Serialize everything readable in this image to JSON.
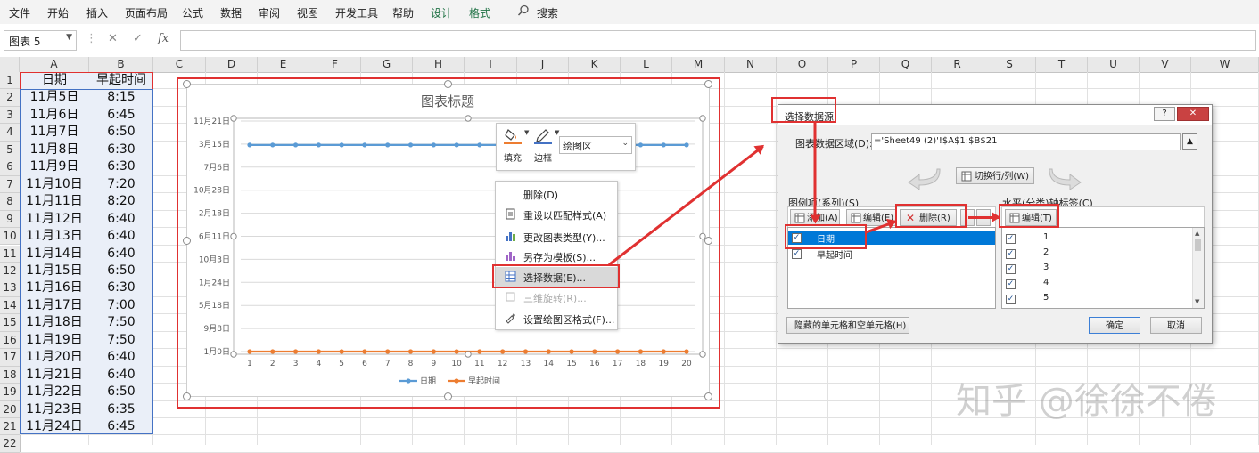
{
  "ribbon": {
    "tabs": [
      "文件",
      "开始",
      "插入",
      "页面布局",
      "公式",
      "数据",
      "审阅",
      "视图",
      "开发工具",
      "帮助",
      "设计",
      "格式"
    ],
    "search_label": "搜索",
    "context_color": "#217346"
  },
  "formula_bar": {
    "name_box": "图表 5",
    "cancel": "✕",
    "enter": "✓",
    "fx": "fx",
    "value": ""
  },
  "columns": [
    "A",
    "B",
    "C",
    "D",
    "E",
    "F",
    "G",
    "H",
    "I",
    "J",
    "K",
    "L",
    "M",
    "N",
    "O",
    "P",
    "Q",
    "R",
    "S",
    "T",
    "U",
    "V",
    "W"
  ],
  "rows": [
    "1",
    "2",
    "3",
    "4",
    "5",
    "6",
    "7",
    "8",
    "9",
    "10",
    "11",
    "12",
    "13",
    "14",
    "15",
    "16",
    "17",
    "18",
    "19",
    "20",
    "21",
    "22"
  ],
  "sheet": {
    "header": [
      "日期",
      "早起时间"
    ],
    "data": [
      [
        "11月5日",
        "8:15"
      ],
      [
        "11月6日",
        "6:45"
      ],
      [
        "11月7日",
        "6:50"
      ],
      [
        "11月8日",
        "6:30"
      ],
      [
        "11月9日",
        "6:30"
      ],
      [
        "11月10日",
        "7:20"
      ],
      [
        "11月11日",
        "8:20"
      ],
      [
        "11月12日",
        "6:40"
      ],
      [
        "11月13日",
        "6:40"
      ],
      [
        "11月14日",
        "6:40"
      ],
      [
        "11月15日",
        "6:50"
      ],
      [
        "11月16日",
        "6:30"
      ],
      [
        "11月17日",
        "7:00"
      ],
      [
        "11月18日",
        "7:50"
      ],
      [
        "11月19日",
        "7:50"
      ],
      [
        "11月20日",
        "6:40"
      ],
      [
        "11月21日",
        "6:40"
      ],
      [
        "11月22日",
        "6:50"
      ],
      [
        "11月23日",
        "6:35"
      ],
      [
        "11月24日",
        "6:45"
      ]
    ]
  },
  "chart": {
    "title": "图表标题",
    "colors": {
      "date": "#5b9bd5",
      "wake": "#ed7d31"
    },
    "chart_data": {
      "type": "line",
      "title": "图表标题",
      "x": [
        1,
        2,
        3,
        4,
        5,
        6,
        7,
        8,
        9,
        10,
        11,
        12,
        13,
        14,
        15,
        16,
        17,
        18,
        19,
        20
      ],
      "y_tick_labels": [
        "1月0日",
        "9月8日",
        "5月18日",
        "1月24日",
        "10月3日",
        "6月11日",
        "2月18日",
        "10月28日",
        "7月6日",
        "3月15日",
        "11月21日"
      ],
      "series": [
        {
          "name": "日期",
          "values": [
            "11月5日",
            "11月6日",
            "11月7日",
            "11月8日",
            "11月9日",
            "11月10日",
            "11月11日",
            "11月12日",
            "11月13日",
            "11月14日",
            "11月15日",
            "11月16日",
            "11月17日",
            "11月18日",
            "11月19日",
            "11月20日",
            "11月21日",
            "11月22日",
            "11月23日",
            "11月24日"
          ]
        },
        {
          "name": "早起时间",
          "values": [
            "8:15",
            "6:45",
            "6:50",
            "6:30",
            "6:30",
            "7:20",
            "8:20",
            "6:40",
            "6:40",
            "6:40",
            "6:50",
            "6:30",
            "7:00",
            "7:50",
            "7:50",
            "6:40",
            "6:40",
            "6:50",
            "6:35",
            "6:45"
          ]
        }
      ],
      "legend": "bottom",
      "grid": true
    }
  },
  "mini_toolbar": {
    "fill": "填充",
    "border": "边框",
    "dropdown": "绘图区"
  },
  "context_menu": {
    "items": [
      {
        "label": "删除(D)",
        "disabled": false
      },
      {
        "label": "重设以匹配样式(A)",
        "disabled": false
      },
      {
        "label": "更改图表类型(Y)...",
        "disabled": false
      },
      {
        "label": "另存为模板(S)...",
        "disabled": false
      },
      {
        "label": "选择数据(E)...",
        "disabled": false
      },
      {
        "label": "三维旋转(R)...",
        "disabled": true
      },
      {
        "label": "设置绘图区格式(F)...",
        "disabled": false
      }
    ]
  },
  "dialog": {
    "title": "选择数据源",
    "help": "?",
    "close": "✕",
    "range_label": "图表数据区域(D):",
    "range_value": "='Sheet49 (2)'!$A$1:$B$21",
    "switch_button": "切换行/列(W)",
    "legend_label": "图例项(系列)(S)",
    "add_button": "添加(A)",
    "edit_button": "编辑(E)",
    "remove_button": "删除(R)",
    "series": [
      "日期",
      "早起时间"
    ],
    "axis_label": "水平(分类)轴标签(C)",
    "axis_edit_button": "编辑(T)",
    "axis_items": [
      "1",
      "2",
      "3",
      "4",
      "5"
    ],
    "hidden_cells_button": "隐藏的单元格和空单元格(H)",
    "ok_button": "确定",
    "cancel_button": "取消"
  },
  "watermark": "知乎 @徐徐不倦",
  "annotation_color": "#e03131"
}
